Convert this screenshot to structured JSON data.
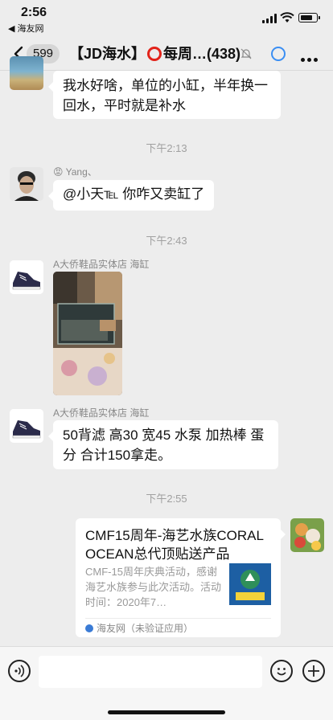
{
  "status_bar": {
    "time": "2:56",
    "back_app": "◀ 海友网"
  },
  "nav": {
    "unread_count": "599",
    "title_prefix": "【JD海水】",
    "title_suffix": "每周…(438)"
  },
  "messages": [
    {
      "type": "text",
      "text": "我水好啥，单位的小缸，半年换一回水，平时就是补水"
    },
    {
      "type": "time",
      "text": "下午2:13"
    },
    {
      "type": "text",
      "sender": "Yang、",
      "text": "@小天℡ 你咋又卖缸了"
    },
    {
      "type": "time",
      "text": "下午2:43"
    },
    {
      "type": "image",
      "sender": "A大侨鞋品实体店 海缸"
    },
    {
      "type": "text",
      "sender": "A大侨鞋品实体店 海缸",
      "text": "50背滤 高30 宽45 水泵 加热棒 蛋分 合计150拿走。"
    },
    {
      "type": "time",
      "text": "下午2:55"
    },
    {
      "type": "link_card",
      "title": "CMF15周年-海艺水族CORAL OCEAN总代顶贴送产品",
      "description": "CMF-15周年庆典活动，感谢海艺水族参与此次活动。活动时间：2020年7…",
      "source": "海友网（未验证应用）"
    }
  ],
  "colors": {
    "background": "#ededed",
    "bubble": "#ffffff",
    "accent_red": "#e2231a",
    "accent_blue": "#3a8ef3"
  }
}
